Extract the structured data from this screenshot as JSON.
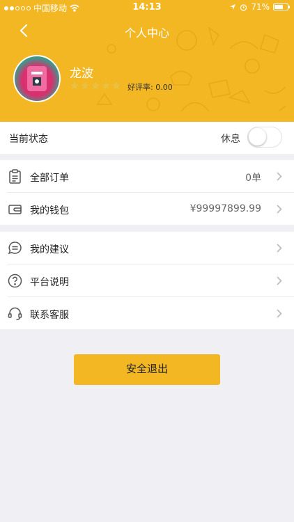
{
  "status_bar": {
    "carrier": "中国移动",
    "time": "14:13",
    "battery": "71%",
    "battery_level": 0.71
  },
  "header": {
    "title": "个人中心",
    "user": {
      "name": "龙波",
      "rating_label": "好评率:",
      "rating_value": "0.00",
      "stars_filled": 0,
      "stars_total": 5
    }
  },
  "status_row": {
    "label": "当前状态",
    "state_label": "休息",
    "toggle_on": false
  },
  "menu_group_1": [
    {
      "label": "全部订单",
      "value": "0单",
      "icon": "clipboard-icon"
    },
    {
      "label": "我的钱包",
      "value": "¥99997899.99",
      "icon": "wallet-icon"
    }
  ],
  "menu_group_2": [
    {
      "label": "我的建议",
      "icon": "chat-bubble-icon"
    },
    {
      "label": "平台说明",
      "icon": "question-circle-icon"
    },
    {
      "label": "联系客服",
      "icon": "headset-icon"
    }
  ],
  "logout_label": "安全退出",
  "colors": {
    "brand": "#f3b723",
    "background": "#efeff4"
  }
}
